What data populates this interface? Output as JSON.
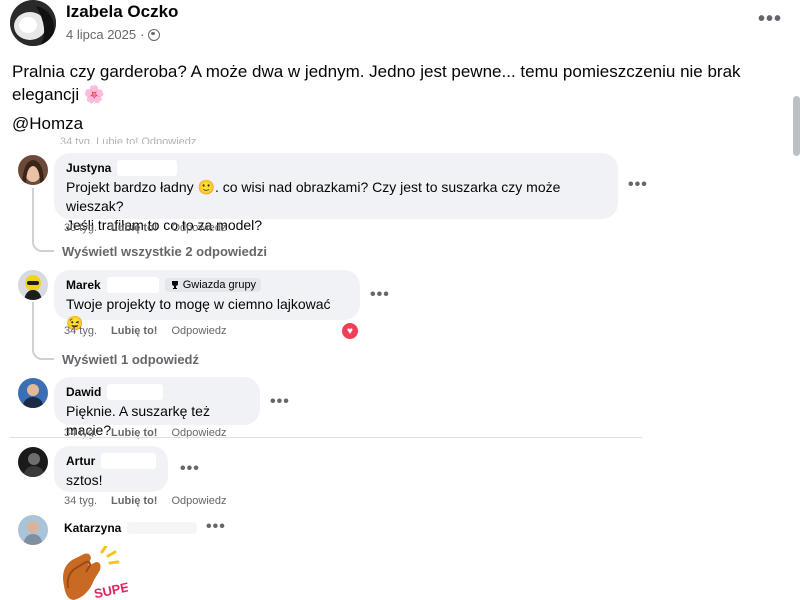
{
  "post": {
    "author": "Izabela Oczko",
    "date": "4 lipca 2025",
    "dot": "·",
    "text": "Pralnia czy garderoba? A może dwa w jednym. Jedno jest pewne... temu pomieszczeniu nie brak elegancji 🌸",
    "mention": "@Homza",
    "more_label": "•••"
  },
  "hidden_actions": "34 tyg.   Lubię to!   Odpowiedz",
  "comments": [
    {
      "name": "Justyna",
      "text_line1": "Projekt bardzo ładny 🙂. co wisi nad obrazkami? Czy jest to suszarka czy może wieszak?",
      "text_line2": "Jeśli trafiłam to co to za model?",
      "time": "30 tyg.",
      "like": "Lubię to!",
      "reply": "Odpowiedz",
      "view_replies": "Wyświetl wszystkie 2 odpowiedzi",
      "more": "•••"
    },
    {
      "name": "Marek",
      "badge": "Gwiazda grupy",
      "text": "Twoje projekty to mogę w ciemno lajkować 😉",
      "time": "34 tyg.",
      "like": "Lubię to!",
      "reply": "Odpowiedz",
      "view_replies": "Wyświetl 1 odpowiedź",
      "more": "•••"
    },
    {
      "name": "Dawid",
      "text": "Pięknie. A suszarkę też macie?",
      "time": "34 tyg.",
      "like": "Lubię to!",
      "reply": "Odpowiedz",
      "more": "•••"
    },
    {
      "name": "Artur",
      "text": "sztos!",
      "time": "34 tyg.",
      "like": "Lubię to!",
      "reply": "Odpowiedz",
      "more": "•••"
    },
    {
      "name": "Katarzyna",
      "more": "•••"
    }
  ],
  "sticker_text": "SUPER!",
  "colors": {
    "bubble": "#f0f2f5",
    "muted": "#65676b",
    "heart": "#f33e58",
    "text": "#050505"
  },
  "icons": [
    "globe-icon",
    "trophy-icon",
    "heart-reaction-icon",
    "more-options-icon"
  ]
}
